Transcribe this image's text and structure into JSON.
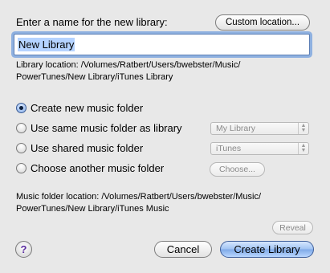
{
  "dialog": {
    "prompt": "Enter a name for the new library:",
    "custom_location_label": "Custom location...",
    "name_value": "New Library",
    "library_location_line1": "Library location: /Volumes/Ratbert/Users/bwebster/Music/",
    "library_location_line2": "PowerTunes/New Library/iTunes Library",
    "options": [
      {
        "label": "Create new music folder",
        "selected": true
      },
      {
        "label": "Use same music folder as library",
        "selected": false
      },
      {
        "label": "Use shared music folder",
        "selected": false
      },
      {
        "label": "Choose another music folder",
        "selected": false
      }
    ],
    "same_folder_popup_value": "My Library",
    "shared_folder_popup_value": "iTunes",
    "choose_button_label": "Choose...",
    "music_location_line1": "Music folder location: /Volumes/Ratbert/Users/bwebster/Music/",
    "music_location_line2": "PowerTunes/New Library/iTunes Music",
    "reveal_label": "Reveal",
    "help_label": "?",
    "cancel_label": "Cancel",
    "create_label": "Create Library"
  }
}
